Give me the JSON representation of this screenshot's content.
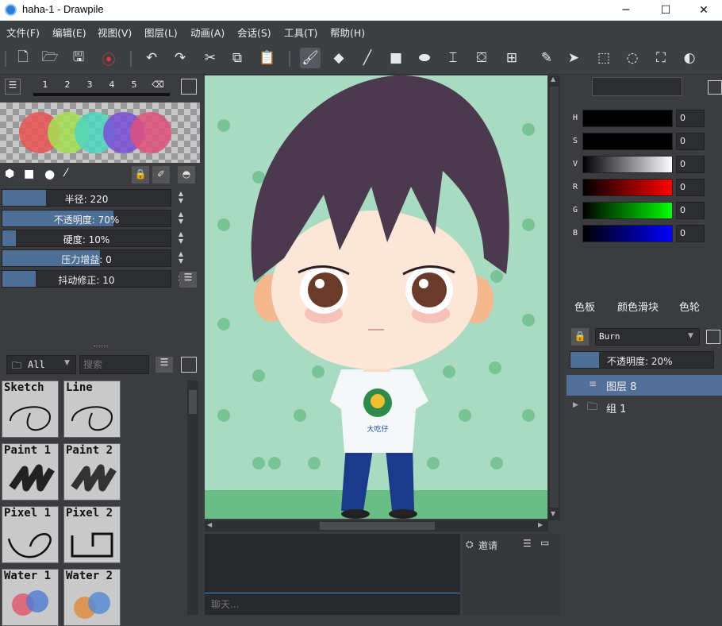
{
  "window": {
    "title": "haha-1 - Drawpile",
    "min": "─",
    "max": "☐",
    "close": "✕"
  },
  "menu": [
    "文件(F)",
    "编辑(E)",
    "视图(V)",
    "图层(L)",
    "动画(A)",
    "会话(S)",
    "工具(T)",
    "帮助(H)"
  ],
  "brush_tabs": [
    "1",
    "2",
    "3",
    "4",
    "5"
  ],
  "sliders": [
    {
      "label": "半径: 220",
      "fill": 0.26
    },
    {
      "label": "不透明度: 70%",
      "fill": 0.66
    },
    {
      "label": "硬度: 10%",
      "fill": 0.08
    },
    {
      "label": "压力增益: 0",
      "fill": 0.58
    },
    {
      "label": "抖动修正: 10",
      "fill": 0.2
    }
  ],
  "brush_filter": {
    "folder": "All",
    "search_placeholder": "搜索"
  },
  "brushes": [
    "Sketch",
    "Line",
    "Paint 1",
    "Paint 2",
    "Pixel 1",
    "Pixel 2",
    "Water 1",
    "Water 2"
  ],
  "color_sliders": [
    {
      "label": "H",
      "value": "0"
    },
    {
      "label": "S",
      "value": "0"
    },
    {
      "label": "V",
      "value": "0"
    },
    {
      "label": "R",
      "value": "0"
    },
    {
      "label": "G",
      "value": "0"
    },
    {
      "label": "B",
      "value": "0"
    }
  ],
  "color_tabs": [
    "色板",
    "颜色滑块",
    "色轮"
  ],
  "layers": {
    "blend_mode": "Burn",
    "opacity_label": "不透明度: 20%",
    "items": [
      {
        "name": "图层 8"
      },
      {
        "name": "组 1"
      }
    ]
  },
  "chat": {
    "placeholder": "聊天..."
  },
  "users": {
    "invite_label": "邀请"
  },
  "canvas": {
    "shirt_text": "大吃仔"
  }
}
